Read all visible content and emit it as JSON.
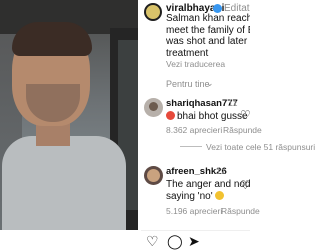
{
  "post": {
    "username": "viralbhayani",
    "edited_label": "Editat",
    "caption_lines": [
      "Salman khan reached to",
      "meet the family of Baba",
      "was shot and later died",
      "treatment"
    ],
    "see_translation": "Vezi traducerea"
  },
  "for_you": {
    "label": "Pentru tine",
    "chevron": "⌄"
  },
  "comments": [
    {
      "username": "shariqhasan777",
      "time": "1z",
      "text": "bhai bhot gusse me",
      "likes": "8.362 aprecieri",
      "reply": "Răspunde",
      "view_replies": "Vezi toate cele 51 răspunsuri"
    },
    {
      "username": "afreen_shk26",
      "time": "1z",
      "text_lines": [
        "The anger and nodding",
        "saying 'no'"
      ],
      "likes": "5.196 aprecieri",
      "reply": "Răspunde"
    }
  ],
  "icons": {
    "like": "♡",
    "comment": "◯",
    "share": "➤",
    "verified": "verified-badge-icon",
    "more": "⋯"
  },
  "colors": {
    "verified_blue": "#3897f0",
    "secondary_text": "#8e8e8e"
  }
}
